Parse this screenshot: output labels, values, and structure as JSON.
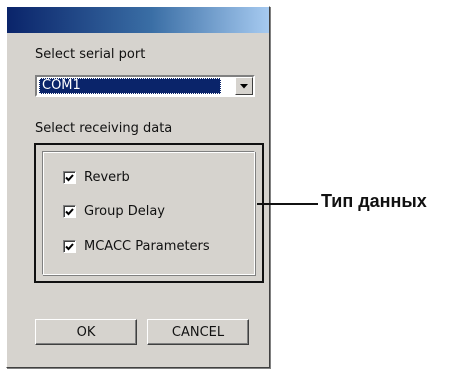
{
  "dialog": {
    "port_label": "Select serial port",
    "port_value": "COM1",
    "receive_label": "Select receiving data",
    "options": [
      {
        "label": "Reverb",
        "checked": true
      },
      {
        "label": "Group Delay",
        "checked": true
      },
      {
        "label": "MCACC Parameters",
        "checked": true
      }
    ],
    "ok_label": "OK",
    "cancel_label": "CANCEL"
  },
  "callout": {
    "text": "Тип данных"
  },
  "colors": {
    "dialog_bg": "#d6d3ce",
    "title_start": "#0a246a",
    "title_end": "#a6caf0",
    "selection_bg": "#0a246a"
  },
  "icons": {
    "dropdown": "chevron-down-icon",
    "check": "checkmark-icon"
  }
}
